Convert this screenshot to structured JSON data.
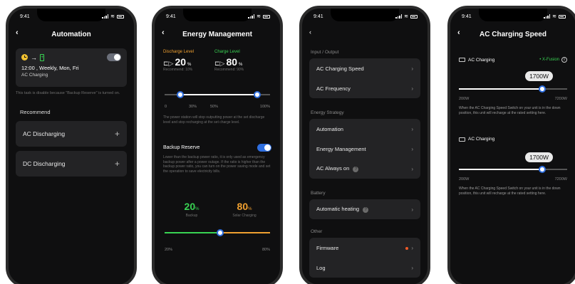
{
  "status_time": "9:41",
  "phone1": {
    "title": "Automation",
    "task": {
      "arrow": "→",
      "schedule": "12:00 , Weekly, Mon, Fri",
      "mode": "AC Charging"
    },
    "note": "This task is disable because \"Backup Reserve\" is turned on.",
    "recommend_label": "Recommend",
    "items": [
      {
        "label": "AC Discharging",
        "action": "+"
      },
      {
        "label": "DC Discharging",
        "action": "+"
      }
    ]
  },
  "phone2": {
    "title": "Energy Management",
    "discharge": {
      "label": "Discharge Level",
      "value": "20",
      "unit": "%",
      "recommend": "Recommend: 10%"
    },
    "charge": {
      "label": "Charge Level",
      "value": "80",
      "unit": "%",
      "recommend": "Recommend: 90%"
    },
    "ticks": [
      "0",
      "30%",
      "50%",
      "100%"
    ],
    "description": "The power station will stop outputting power at the set discharge level and stop recharging at the set charge level.",
    "backup_label": "Backup Reserve",
    "backup_description": "Lower than the backup power ratio, it is only used as emergency backup power after a power outage. If the ratio is higher than the backup power ratio, you can turn on the power saving mode and set the operation to save electricity bills.",
    "backup_value": "20",
    "backup_unit": "%",
    "backup_caption": "Backup",
    "solar_value": "80",
    "solar_unit": "%",
    "solar_caption": "Solar Charging",
    "bottom_ticks": [
      "20%",
      "80%"
    ],
    "colors": {
      "discharge": "#f0a030",
      "charge": "#39d353"
    }
  },
  "phone3": {
    "sections": [
      {
        "label": "Input / Output",
        "items": [
          "AC Charging Speed",
          "AC Frequency"
        ]
      },
      {
        "label": "Energy Strategy",
        "items": [
          "Automation",
          "Energy Management",
          "AC Always on"
        ]
      },
      {
        "label": "Battery",
        "items": [
          "Automatic heating"
        ]
      },
      {
        "label": "Other",
        "items": [
          "Firmware",
          "Log"
        ]
      }
    ],
    "help_icon": "?"
  },
  "phone4": {
    "title": "AC Charging Speed",
    "block1": {
      "label": "AC Charging",
      "badge": "• X-Fusion",
      "info_icon": "i",
      "value": "1700W",
      "min": "200W",
      "max": "7200W",
      "note": "When the AC Charging Speed Switch on your unit is in the down position, this unit will recharge at the rated setting here."
    },
    "block2": {
      "label": "AC Charging",
      "value": "1700W",
      "min": "200W",
      "max": "7200W",
      "note": "When the AC Charging Speed Switch on your unit is in the down position, this unit will recharge at the rated setting here."
    },
    "colors": {
      "badge": "#39d353"
    }
  }
}
